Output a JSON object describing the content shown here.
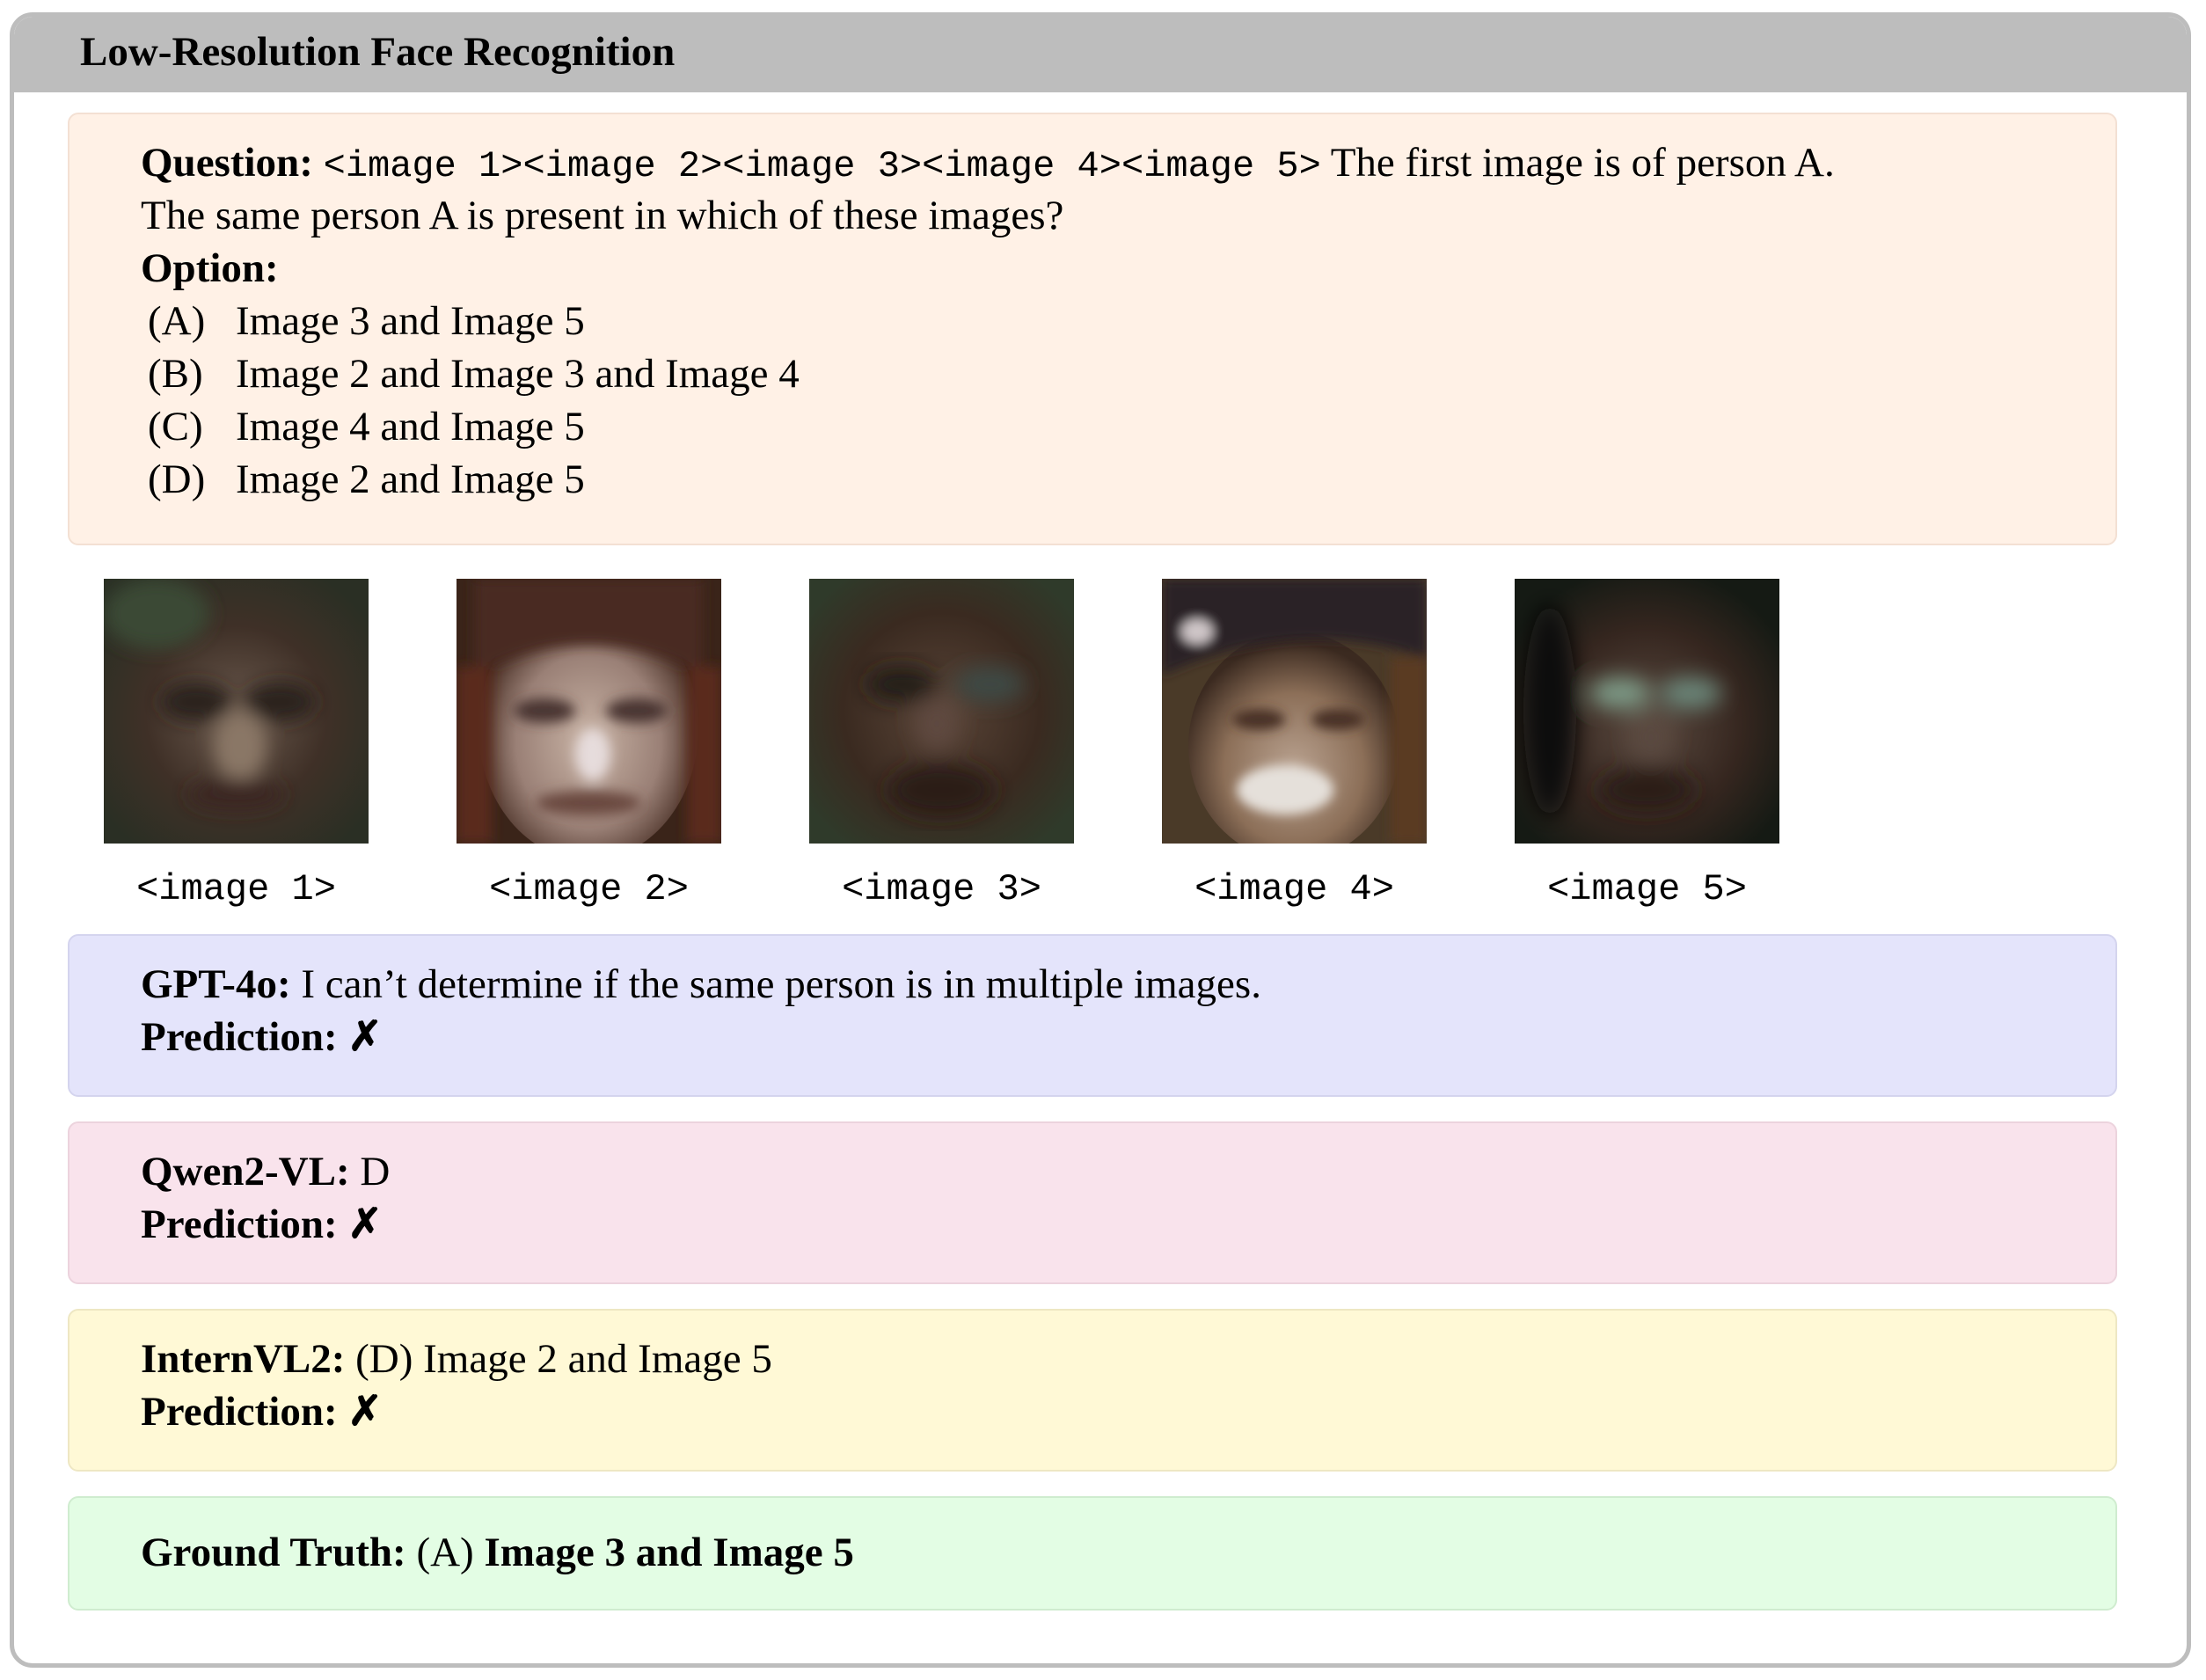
{
  "header": {
    "title": "Low-Resolution Face Recognition"
  },
  "question": {
    "label": "Question:",
    "image_tokens": "<image 1><image 2><image 3><image 4><image 5>",
    "text_line1": " The first image is of person A.",
    "text_line2": "The same person A is present in which of these images?"
  },
  "options": {
    "label": "Option:",
    "items": [
      {
        "letter": "(A)",
        "text": "Image 3 and Image 5"
      },
      {
        "letter": "(B)",
        "text": "Image 2 and Image 3 and Image 4"
      },
      {
        "letter": "(C)",
        "text": "Image 4 and Image 5"
      },
      {
        "letter": "(D)",
        "text": "Image 2 and Image 5"
      }
    ]
  },
  "images": [
    {
      "caption": "<image 1>",
      "description": "blurry dark face"
    },
    {
      "caption": "<image 2>",
      "description": "blurry smiling face with dark hair"
    },
    {
      "caption": "<image 3>",
      "description": "blurry dark face"
    },
    {
      "caption": "<image 4>",
      "description": "blurry face with dark cap"
    },
    {
      "caption": "<image 5>",
      "description": "blurry dark face"
    }
  ],
  "answers": {
    "gpt": {
      "model": "GPT-4o:",
      "text": " I can’t determine if the same person is in multiple images.",
      "prediction_label": "Prediction:",
      "mark": "✗"
    },
    "qwen": {
      "model": "Qwen2-VL:",
      "text": " D",
      "prediction_label": "Prediction:",
      "mark": "✗"
    },
    "intern": {
      "model": "InternVL2:",
      "text": " (D) Image 2 and Image 5",
      "prediction_label": "Prediction:",
      "mark": "✗"
    },
    "ground_truth": {
      "label": "Ground Truth:",
      "letter": " (A) ",
      "text": "Image 3 and Image 5"
    }
  },
  "colors": {
    "header": "#bdbdbd",
    "question_bg": "#fff1e6",
    "gpt_bg": "#e4e4fb",
    "qwen_bg": "#f9e3ec",
    "intern_bg": "#fff9d6",
    "ground_truth_bg": "#e3fde4"
  }
}
